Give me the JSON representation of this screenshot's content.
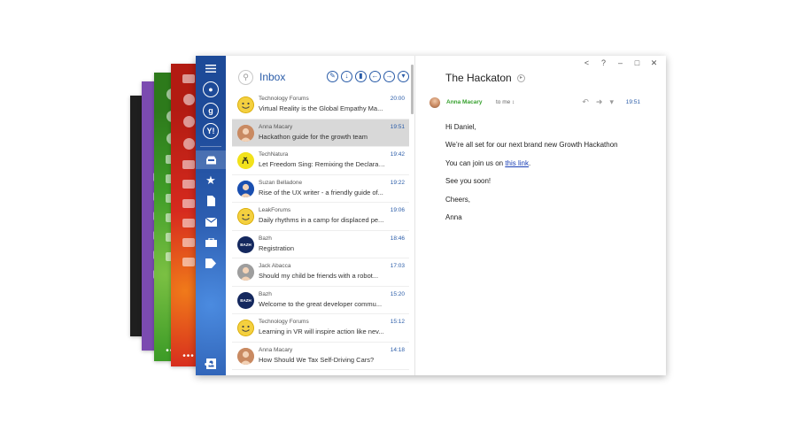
{
  "theme_cards": [
    {
      "name": "black-theme"
    },
    {
      "name": "purple-theme"
    },
    {
      "name": "green-theme"
    },
    {
      "name": "red-theme"
    }
  ],
  "rail": {
    "more_label": "•••",
    "icons": [
      "menu-icon",
      "contacts-icon",
      "google-icon",
      "yahoo-icon",
      "inbox-icon",
      "star-icon",
      "document-icon",
      "mail-icon",
      "briefcase-icon",
      "tag-icon",
      "contact-book-icon"
    ]
  },
  "list": {
    "title": "Inbox",
    "messages": [
      {
        "sender": "Technology Forums",
        "subject": "Virtual Reality is the Global Empathy Ma...",
        "time": "20:00",
        "avatar": "smiley",
        "avatar_color": "#f4d03f"
      },
      {
        "sender": "Anna Macary",
        "subject": "Hackathon guide for the growth team",
        "time": "19:51",
        "avatar": "photo",
        "avatar_color": "#c98a62",
        "selected": true
      },
      {
        "sender": "TechNatura",
        "subject": "Let Freedom Sing: Remixing the Declarati...",
        "time": "19:42",
        "avatar": "deer",
        "avatar_color": "#f2e21b"
      },
      {
        "sender": "Suzan Belladone",
        "subject": "Rise of the UX writer - a friendly guide of...",
        "time": "19:22",
        "avatar": "photo",
        "avatar_color": "#1a4fb0"
      },
      {
        "sender": "LeakForums",
        "subject": "Daily rhythms in a camp for displaced pe...",
        "time": "19:06",
        "avatar": "smiley",
        "avatar_color": "#f4d03f"
      },
      {
        "sender": "Bazh",
        "subject": "Registration",
        "time": "18:46",
        "avatar": "BAZH",
        "avatar_color": "#14285e"
      },
      {
        "sender": "Jack Abacca",
        "subject": "Should my child be friends with a robot...",
        "time": "17:03",
        "avatar": "photo",
        "avatar_color": "#9e9e9e"
      },
      {
        "sender": "Bazh",
        "subject": "Welcome to the great developer commu...",
        "time": "15:20",
        "avatar": "BAZH",
        "avatar_color": "#14285e"
      },
      {
        "sender": "Technology Forums",
        "subject": "Learning in VR will inspire action like nev...",
        "time": "15:12",
        "avatar": "smiley",
        "avatar_color": "#f4d03f"
      },
      {
        "sender": "Anna Macary",
        "subject": "How Should We Tax Self-Driving Cars?",
        "time": "14:18",
        "avatar": "photo",
        "avatar_color": "#c98a62"
      }
    ]
  },
  "toolbar": {
    "buttons": [
      "compose-icon",
      "download-icon",
      "trash-icon",
      "reply-icon",
      "forward-icon",
      "more-icon"
    ]
  },
  "window_controls": {
    "back": "<",
    "help": "?",
    "minimize": "–",
    "maximize": "□",
    "close": "✕"
  },
  "reading": {
    "title": "The Hackaton",
    "from": "Anna Macary",
    "to": "to me ↕",
    "time": "19:51",
    "greeting": "Hi Daniel,",
    "line1": "We’re all set for our next brand new Growth Hackathon",
    "line2_prefix": "You can join us on ",
    "line2_link": "this link",
    "line2_suffix": ".",
    "line3": "See you soon!",
    "signoff": "Cheers,",
    "signature": "Anna"
  },
  "colors": {
    "rail": "#2c5db0",
    "accent": "#2a5ca8",
    "sender_green": "#37a12e",
    "link": "#1a3fb5"
  }
}
